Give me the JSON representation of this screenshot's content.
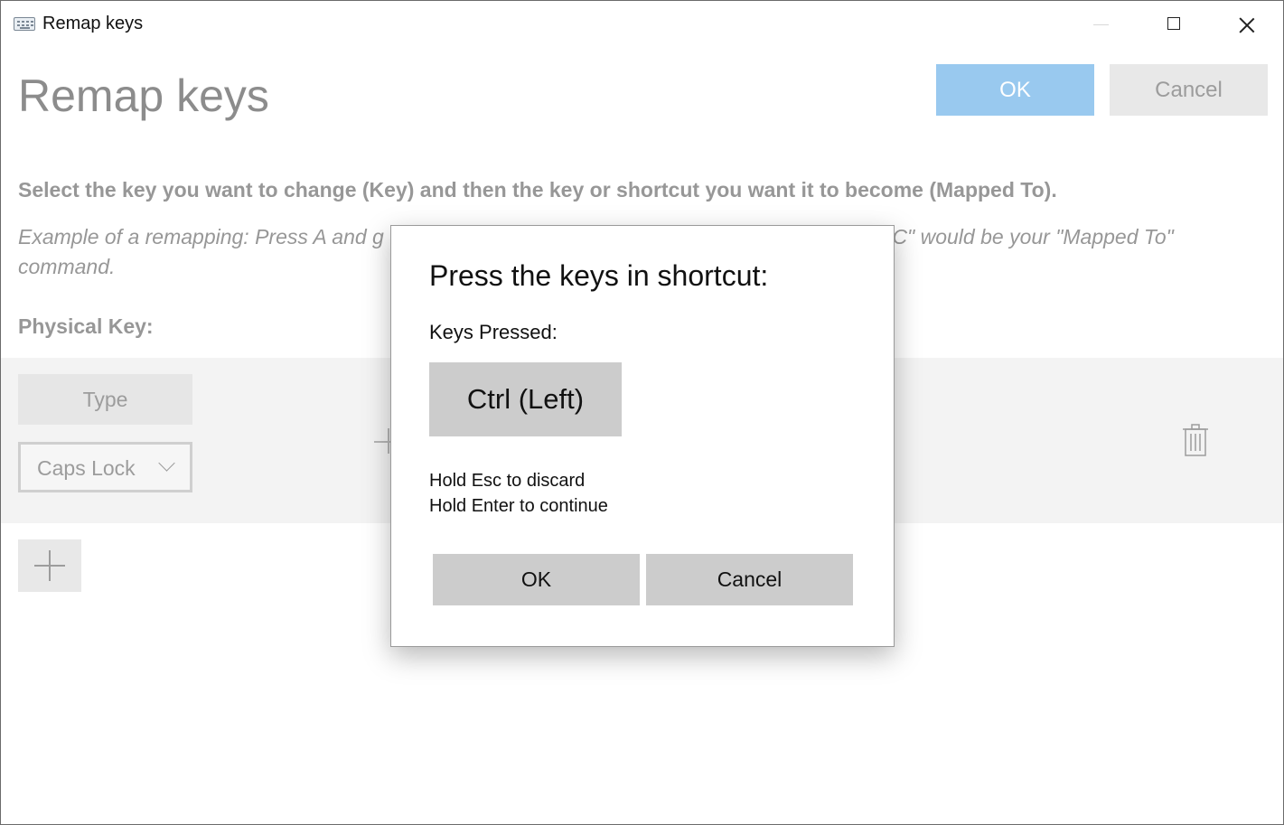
{
  "window": {
    "title": "Remap keys",
    "controls": [
      "minimize",
      "maximize",
      "close"
    ]
  },
  "page": {
    "title": "Remap keys",
    "ok_label": "OK",
    "cancel_label": "Cancel",
    "instruction": "Select the key you want to change (Key) and then the key or shortcut you want it to become (Mapped To).",
    "example_left": "Example of a remapping: Press A and g",
    "example_right": "trl+C\" would be your \"Mapped To\"",
    "example_line2": "command.",
    "physical_key_label": "Physical Key:",
    "row": {
      "type_label": "Type",
      "selected_key": "Caps Lock"
    }
  },
  "dialog": {
    "title": "Press the keys in shortcut:",
    "keys_pressed_label": "Keys Pressed:",
    "pressed_key": "Ctrl (Left)",
    "hint_discard": "Hold Esc to discard",
    "hint_continue": "Hold Enter to continue",
    "ok_label": "OK",
    "cancel_label": "Cancel"
  },
  "icons": {
    "app": "keyboard-icon",
    "delete": "trash-icon",
    "add": "plus-icon",
    "dropdown": "chevron-down-icon"
  },
  "colors": {
    "accent_disabled": "#99c9ef",
    "dialog_button": "#cccccc",
    "row_band": "#f3f3f3"
  }
}
